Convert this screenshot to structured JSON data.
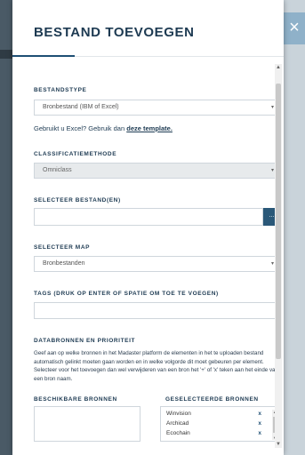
{
  "modal": {
    "title": "BESTAND TOEVOEGEN",
    "close_glyph": "×"
  },
  "bestandstype": {
    "label": "BESTANDSTYPE",
    "value": "Bronbestand (IBM of Excel)",
    "help_prefix": "Gebruikt u Excel? Gebruik dan ",
    "help_link": "deze template."
  },
  "classificatie": {
    "label": "CLASSIFICATIEMETHODE",
    "value": "Omniclass"
  },
  "bestanden": {
    "label": "SELECTEER BESTAND(EN)",
    "button": "..."
  },
  "map": {
    "label": "SELECTEER MAP",
    "value": "Bronbestanden"
  },
  "tags": {
    "label": "TAGS (DRUK OP ENTER OF SPATIE OM TOE TE VOEGEN)"
  },
  "databronnen": {
    "label": "DATABRONNEN EN PRIORITEIT",
    "description": "Geef aan op welke bronnen in het Madaster platform de elementen in het te uploaden bestand automatisch gelinkt moeten gaan worden en in welke volgorde dit moet gebeuren per element. Selecteer voor het toevoegen dan wel verwijderen van een bron het '+' of 'x' teken aan het einde van een bron naam.",
    "available_label": "BESCHIKBARE BRONNEN",
    "selected_label": "GESELECTEERDE BRONNEN",
    "selected": [
      {
        "name": "Winvision",
        "remove": "x"
      },
      {
        "name": "Archicad",
        "remove": "x"
      },
      {
        "name": "Ecochain",
        "remove": "x"
      }
    ]
  },
  "icons": {
    "close": "close-icon",
    "caret": "chevron-down-icon",
    "scroll_up": "triangle-up-icon",
    "scroll_down": "triangle-down-icon"
  },
  "colors": {
    "accent": "#1e4f74",
    "file_button": "#2a5878",
    "close_button": "#8fb1c9"
  }
}
